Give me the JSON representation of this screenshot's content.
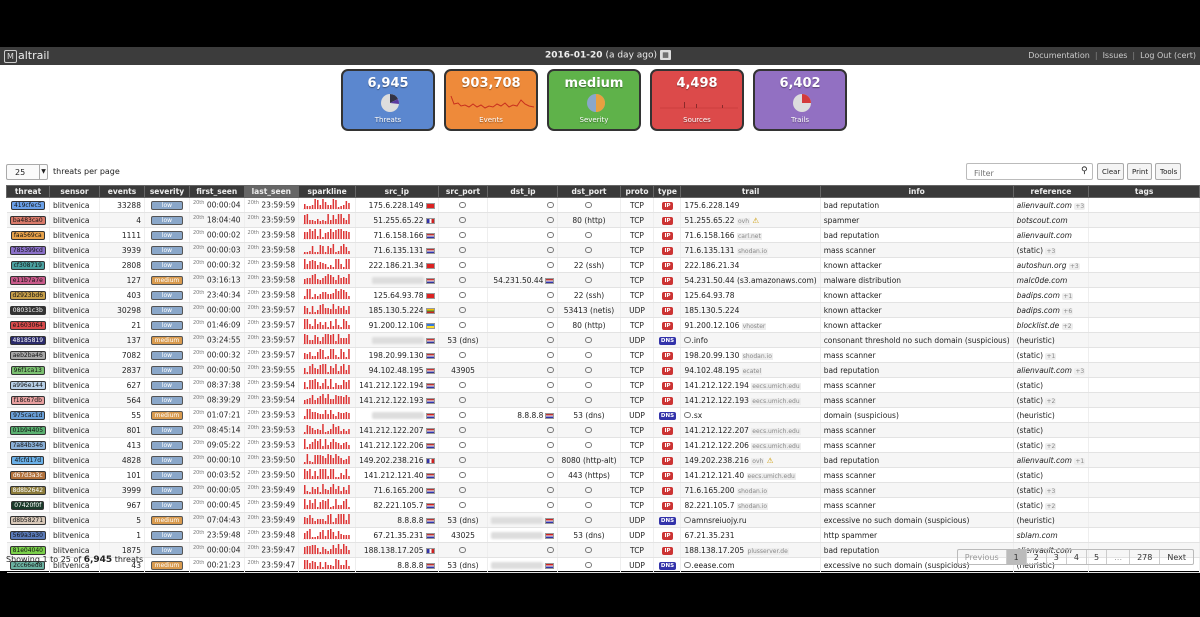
{
  "header": {
    "logo": "altrail",
    "logo_mark": "M",
    "date": "2016-01-20",
    "date_sub": "(a day ago)",
    "calendar_icon": "calendar-icon",
    "links": [
      "Documentation",
      "Issues",
      "Log Out (cert)"
    ]
  },
  "cards": [
    {
      "value": "6,945",
      "label": "Threats",
      "color": "#5b87cf",
      "icon": "pie-icon"
    },
    {
      "value": "903,708",
      "label": "Events",
      "color": "#ee8a3a",
      "icon": "sparkline-icon"
    },
    {
      "value": "medium",
      "label": "Severity",
      "color": "#5fb24a",
      "icon": "pie-icon"
    },
    {
      "value": "4,498",
      "label": "Sources",
      "color": "#dc4a4a",
      "icon": "bars-icon"
    },
    {
      "value": "6,402",
      "label": "Trails",
      "color": "#9270c2",
      "icon": "pie-icon"
    }
  ],
  "controls": {
    "page_len": "25",
    "page_len_label": "threats per page",
    "filter_placeholder": "Filter",
    "buttons": [
      "Clear",
      "Print",
      "Tools"
    ]
  },
  "table": {
    "columns": [
      "threat",
      "sensor",
      "events",
      "severity",
      "first_seen",
      "last_seen",
      "sparkline",
      "src_ip",
      "src_port",
      "dst_ip",
      "dst_port",
      "proto",
      "type",
      "trail",
      "info",
      "reference",
      "tags"
    ],
    "rows": [
      {
        "threat": "419cfec5",
        "tc": "#6aa0e8",
        "sensor": "blitvenica",
        "events": "33288",
        "sev": "low",
        "fs": "00:00:04",
        "ls": "23:59:59",
        "src_ip": "175.6.228.149",
        "src_flag": "cn",
        "src_port": "",
        "dst_ip": "",
        "dst_flag": "",
        "dst_port": "",
        "proto": "TCP",
        "type": "IP",
        "trail": "175.6.228.149",
        "trail_note": "",
        "warn": false,
        "info": "bad reputation",
        "ref": "alienvault.com",
        "ref_extra": "+3",
        "ital": true
      },
      {
        "threat": "ba483ca0",
        "tc": "#d97a6a",
        "sensor": "blitvenica",
        "events": "4",
        "sev": "low",
        "fs": "18:04:40",
        "ls": "23:59:59",
        "src_ip": "51.255.65.22",
        "src_flag": "fr",
        "src_port": "",
        "dst_ip": "",
        "dst_flag": "",
        "dst_port": "80 (http)",
        "proto": "TCP",
        "type": "IP",
        "trail": "51.255.65.22",
        "trail_note": "ovh",
        "warn": true,
        "info": "spammer",
        "ref": "botscout.com",
        "ref_extra": "",
        "ital": true
      },
      {
        "threat": "faa569ca",
        "tc": "#e8a24a",
        "sensor": "blitvenica",
        "events": "1111",
        "sev": "low",
        "fs": "00:00:02",
        "ls": "23:59:58",
        "src_ip": "71.6.158.166",
        "src_flag": "us",
        "src_port": "",
        "dst_ip": "",
        "dst_flag": "",
        "dst_port": "",
        "proto": "TCP",
        "type": "IP",
        "trail": "71.6.158.166",
        "trail_note": "carl.net",
        "warn": false,
        "info": "bad reputation",
        "ref": "alienvault.com",
        "ref_extra": "",
        "ital": true
      },
      {
        "threat": "785399cd",
        "tc": "#8a70c8",
        "sensor": "blitvenica",
        "events": "3939",
        "sev": "low",
        "fs": "00:00:03",
        "ls": "23:59:58",
        "src_ip": "71.6.135.131",
        "src_flag": "us",
        "src_port": "",
        "dst_ip": "",
        "dst_flag": "",
        "dst_port": "",
        "proto": "TCP",
        "type": "IP",
        "trail": "71.6.135.131",
        "trail_note": "shodan.io",
        "warn": false,
        "info": "mass scanner",
        "ref": "(static)",
        "ref_extra": "+3",
        "ital": false
      },
      {
        "threat": "cf308719",
        "tc": "#4aa0a0",
        "sensor": "blitvenica",
        "events": "2808",
        "sev": "low",
        "fs": "00:00:32",
        "ls": "23:59:58",
        "src_ip": "222.186.21.34",
        "src_flag": "cn",
        "src_port": "",
        "dst_ip": "",
        "dst_flag": "",
        "dst_port": "22 (ssh)",
        "proto": "TCP",
        "type": "IP",
        "trail": "222.186.21.34",
        "trail_note": "",
        "warn": false,
        "info": "known attacker",
        "ref": "autoshun.org",
        "ref_extra": "+3",
        "ital": true
      },
      {
        "threat": "e11b7a7e",
        "tc": "#c85a8a",
        "sensor": "blitvenica",
        "events": "127",
        "sev": "medium",
        "fs": "03:16:13",
        "ls": "23:59:58",
        "src_ip": "",
        "src_flag": "nl",
        "src_port": "",
        "dst_ip": "54.231.50.44",
        "dst_flag": "us",
        "dst_port": "",
        "proto": "TCP",
        "type": "IP",
        "trail": "54.231.50.44 (s3.amazonaws.com)",
        "trail_note": "",
        "warn": false,
        "info": "malware distribution",
        "ref": "malc0de.com",
        "ref_extra": "",
        "ital": true
      },
      {
        "threat": "d2923bd6",
        "tc": "#c8a04a",
        "sensor": "blitvenica",
        "events": "403",
        "sev": "low",
        "fs": "23:40:34",
        "ls": "23:59:58",
        "src_ip": "125.64.93.78",
        "src_flag": "cn",
        "src_port": "",
        "dst_ip": "",
        "dst_flag": "",
        "dst_port": "22 (ssh)",
        "proto": "TCP",
        "type": "IP",
        "trail": "125.64.93.78",
        "trail_note": "",
        "warn": false,
        "info": "known attacker",
        "ref": "badips.com",
        "ref_extra": "+1",
        "ital": true
      },
      {
        "threat": "08031c3b",
        "tc": "#333333",
        "sensor": "blitvenica",
        "events": "30298",
        "sev": "low",
        "fs": "00:00:00",
        "ls": "23:59:57",
        "src_ip": "185.130.5.224",
        "src_flag": "lt",
        "src_port": "",
        "dst_ip": "",
        "dst_flag": "",
        "dst_port": "53413 (netis)",
        "proto": "UDP",
        "type": "IP",
        "trail": "185.130.5.224",
        "trail_note": "",
        "warn": false,
        "info": "known attacker",
        "ref": "badips.com",
        "ref_extra": "+6",
        "ital": true
      },
      {
        "threat": "e1603064",
        "tc": "#d84a4a",
        "sensor": "blitvenica",
        "events": "21",
        "sev": "low",
        "fs": "01:46:09",
        "ls": "23:59:57",
        "src_ip": "91.200.12.106",
        "src_flag": "ua",
        "src_port": "",
        "dst_ip": "",
        "dst_flag": "",
        "dst_port": "80 (http)",
        "proto": "TCP",
        "type": "IP",
        "trail": "91.200.12.106",
        "trail_note": "vhoster",
        "warn": false,
        "info": "known attacker",
        "ref": "blocklist.de",
        "ref_extra": "+2",
        "ital": true
      },
      {
        "threat": "48185819",
        "tc": "#2a2a6a",
        "sensor": "blitvenica",
        "events": "137",
        "sev": "medium",
        "fs": "03:24:55",
        "ls": "23:59:57",
        "src_ip": "",
        "src_flag": "nl",
        "src_port": "53 (dns)",
        "dst_ip": "",
        "dst_flag": "",
        "dst_port": "",
        "proto": "UDP",
        "type": "DNS",
        "trail": ".info",
        "trail_note": "",
        "warn": false,
        "info": "consonant threshold no such domain (suspicious)",
        "ref": "(heuristic)",
        "ref_extra": "",
        "ital": false
      },
      {
        "threat": "aeb2ba46",
        "tc": "#a8a8a8",
        "sensor": "blitvenica",
        "events": "7082",
        "sev": "low",
        "fs": "00:00:32",
        "ls": "23:59:57",
        "src_ip": "198.20.99.130",
        "src_flag": "us",
        "src_port": "",
        "dst_ip": "",
        "dst_flag": "",
        "dst_port": "",
        "proto": "TCP",
        "type": "IP",
        "trail": "198.20.99.130",
        "trail_note": "shodan.io",
        "warn": false,
        "info": "mass scanner",
        "ref": "(static)",
        "ref_extra": "+1",
        "ital": false
      },
      {
        "threat": "96f1ca13",
        "tc": "#7ac070",
        "sensor": "blitvenica",
        "events": "2837",
        "sev": "low",
        "fs": "00:00:50",
        "ls": "23:59:55",
        "src_ip": "94.102.48.195",
        "src_flag": "nl",
        "src_port": "43905",
        "dst_ip": "",
        "dst_flag": "",
        "dst_port": "",
        "proto": "TCP",
        "type": "IP",
        "trail": "94.102.48.195",
        "trail_note": "ecatel",
        "warn": false,
        "info": "bad reputation",
        "ref": "alienvault.com",
        "ref_extra": "+3",
        "ital": true
      },
      {
        "threat": "a996e144",
        "tc": "#b8d0e8",
        "sensor": "blitvenica",
        "events": "627",
        "sev": "low",
        "fs": "08:37:38",
        "ls": "23:59:54",
        "src_ip": "141.212.122.194",
        "src_flag": "us",
        "src_port": "",
        "dst_ip": "",
        "dst_flag": "",
        "dst_port": "",
        "proto": "TCP",
        "type": "IP",
        "trail": "141.212.122.194",
        "trail_note": "eecs.umich.edu",
        "warn": false,
        "info": "mass scanner",
        "ref": "(static)",
        "ref_extra": "",
        "ital": false
      },
      {
        "threat": "f18c67db",
        "tc": "#e8a0a0",
        "sensor": "blitvenica",
        "events": "564",
        "sev": "low",
        "fs": "08:39:29",
        "ls": "23:59:54",
        "src_ip": "141.212.122.193",
        "src_flag": "us",
        "src_port": "",
        "dst_ip": "",
        "dst_flag": "",
        "dst_port": "",
        "proto": "TCP",
        "type": "IP",
        "trail": "141.212.122.193",
        "trail_note": "eecs.umich.edu",
        "warn": false,
        "info": "mass scanner",
        "ref": "(static)",
        "ref_extra": "+2",
        "ital": false
      },
      {
        "threat": "975cac1d",
        "tc": "#6aa0d8",
        "sensor": "blitvenica",
        "events": "55",
        "sev": "medium",
        "fs": "01:07:21",
        "ls": "23:59:53",
        "src_ip": "",
        "src_flag": "hr",
        "src_port": "",
        "dst_ip": "8.8.8.8",
        "dst_flag": "us",
        "dst_port": "53 (dns)",
        "proto": "UDP",
        "type": "DNS",
        "trail": ".sx",
        "trail_note": "",
        "warn": false,
        "info": "domain (suspicious)",
        "ref": "(heuristic)",
        "ref_extra": "",
        "ital": false
      },
      {
        "threat": "01b94405",
        "tc": "#5ab070",
        "sensor": "blitvenica",
        "events": "801",
        "sev": "low",
        "fs": "08:45:14",
        "ls": "23:59:53",
        "src_ip": "141.212.122.207",
        "src_flag": "us",
        "src_port": "",
        "dst_ip": "",
        "dst_flag": "",
        "dst_port": "",
        "proto": "TCP",
        "type": "IP",
        "trail": "141.212.122.207",
        "trail_note": "eecs.umich.edu",
        "warn": false,
        "info": "mass scanner",
        "ref": "(static)",
        "ref_extra": "",
        "ital": false
      },
      {
        "threat": "7a84b346",
        "tc": "#8ab0d8",
        "sensor": "blitvenica",
        "events": "413",
        "sev": "low",
        "fs": "09:05:22",
        "ls": "23:59:53",
        "src_ip": "141.212.122.206",
        "src_flag": "us",
        "src_port": "",
        "dst_ip": "",
        "dst_flag": "",
        "dst_port": "",
        "proto": "TCP",
        "type": "IP",
        "trail": "141.212.122.206",
        "trail_note": "eecs.umich.edu",
        "warn": false,
        "info": "mass scanner",
        "ref": "(static)",
        "ref_extra": "+2",
        "ital": false
      },
      {
        "threat": "4fcfd17d",
        "tc": "#6ab0e8",
        "sensor": "blitvenica",
        "events": "4828",
        "sev": "low",
        "fs": "00:00:10",
        "ls": "23:59:50",
        "src_ip": "149.202.238.216",
        "src_flag": "fr",
        "src_port": "",
        "dst_ip": "",
        "dst_flag": "",
        "dst_port": "8080 (http-alt)",
        "proto": "TCP",
        "type": "IP",
        "trail": "149.202.238.216",
        "trail_note": "ovh",
        "warn": true,
        "info": "bad reputation",
        "ref": "alienvault.com",
        "ref_extra": "+1",
        "ital": true
      },
      {
        "threat": "d67d3a3c",
        "tc": "#b0703a",
        "sensor": "blitvenica",
        "events": "101",
        "sev": "low",
        "fs": "00:03:52",
        "ls": "23:59:50",
        "src_ip": "141.212.121.40",
        "src_flag": "us",
        "src_port": "",
        "dst_ip": "",
        "dst_flag": "",
        "dst_port": "443 (https)",
        "proto": "TCP",
        "type": "IP",
        "trail": "141.212.121.40",
        "trail_note": "eecs.umich.edu",
        "warn": false,
        "info": "mass scanner",
        "ref": "(static)",
        "ref_extra": "",
        "ital": false
      },
      {
        "threat": "8d8b2642",
        "tc": "#8a7a3a",
        "sensor": "blitvenica",
        "events": "3999",
        "sev": "low",
        "fs": "00:00:05",
        "ls": "23:59:49",
        "src_ip": "71.6.165.200",
        "src_flag": "us",
        "src_port": "",
        "dst_ip": "",
        "dst_flag": "",
        "dst_port": "",
        "proto": "TCP",
        "type": "IP",
        "trail": "71.6.165.200",
        "trail_note": "shodan.io",
        "warn": false,
        "info": "mass scanner",
        "ref": "(static)",
        "ref_extra": "+3",
        "ital": false
      },
      {
        "threat": "07420f0f",
        "tc": "#1a3a2a",
        "sensor": "blitvenica",
        "events": "967",
        "sev": "low",
        "fs": "00:00:45",
        "ls": "23:59:49",
        "src_ip": "82.221.105.7",
        "src_flag": "hr",
        "src_port": "",
        "dst_ip": "",
        "dst_flag": "",
        "dst_port": "",
        "proto": "TCP",
        "type": "IP",
        "trail": "82.221.105.7",
        "trail_note": "shodan.io",
        "warn": false,
        "info": "mass scanner",
        "ref": "(static)",
        "ref_extra": "+2",
        "ital": false
      },
      {
        "threat": "d8b58271",
        "tc": "#d8c8b8",
        "sensor": "blitvenica",
        "events": "5",
        "sev": "medium",
        "fs": "07:04:43",
        "ls": "23:59:49",
        "src_ip": "8.8.8.8",
        "src_flag": "us",
        "src_port": "53 (dns)",
        "dst_ip": "",
        "dst_flag": "hr",
        "dst_port": "",
        "proto": "UDP",
        "type": "DNS",
        "trail": "amnsreiuojy.ru",
        "trail_note": "",
        "warn": false,
        "info": "excessive no such domain (suspicious)",
        "ref": "(heuristic)",
        "ref_extra": "",
        "ital": false
      },
      {
        "threat": "569a3a30",
        "tc": "#5a7ab8",
        "sensor": "blitvenica",
        "events": "1",
        "sev": "low",
        "fs": "23:59:48",
        "ls": "23:59:48",
        "src_ip": "67.21.35.231",
        "src_flag": "us",
        "src_port": "43025",
        "dst_ip": "",
        "dst_flag": "hr",
        "dst_port": "53 (dns)",
        "proto": "UDP",
        "type": "IP",
        "trail": "67.21.35.231",
        "trail_note": "",
        "warn": false,
        "info": "http spammer",
        "ref": "sblam.com",
        "ref_extra": "",
        "ital": true
      },
      {
        "threat": "81e04040",
        "tc": "#7ad04a",
        "sensor": "blitvenica",
        "events": "1875",
        "sev": "low",
        "fs": "00:00:04",
        "ls": "23:59:47",
        "src_ip": "188.138.17.205",
        "src_flag": "fr",
        "src_port": "",
        "dst_ip": "",
        "dst_flag": "",
        "dst_port": "",
        "proto": "TCP",
        "type": "IP",
        "trail": "188.138.17.205",
        "trail_note": "plusserver.de",
        "warn": false,
        "info": "bad reputation",
        "ref": "alienvault.com",
        "ref_extra": "",
        "ital": true
      },
      {
        "threat": "2cc66ed8",
        "tc": "#6ab0a0",
        "sensor": "blitvenica",
        "events": "43",
        "sev": "medium",
        "fs": "00:21:23",
        "ls": "23:59:47",
        "src_ip": "8.8.8.8",
        "src_flag": "us",
        "src_port": "53 (dns)",
        "dst_ip": "",
        "dst_flag": "hr",
        "dst_port": "",
        "proto": "UDP",
        "type": "DNS",
        "trail": ".eease.com",
        "trail_note": "",
        "warn": false,
        "info": "excessive no such domain (suspicious)",
        "ref": "(heuristic)",
        "ref_extra": "",
        "ital": false
      }
    ],
    "date_sup": "20th"
  },
  "footer": {
    "showing_prefix": "Showing 1 to 25 of",
    "total": "6,945",
    "suffix": "threats",
    "pages": [
      "Previous",
      "1",
      "2",
      "3",
      "4",
      "5",
      "…",
      "278",
      "Next"
    ]
  }
}
